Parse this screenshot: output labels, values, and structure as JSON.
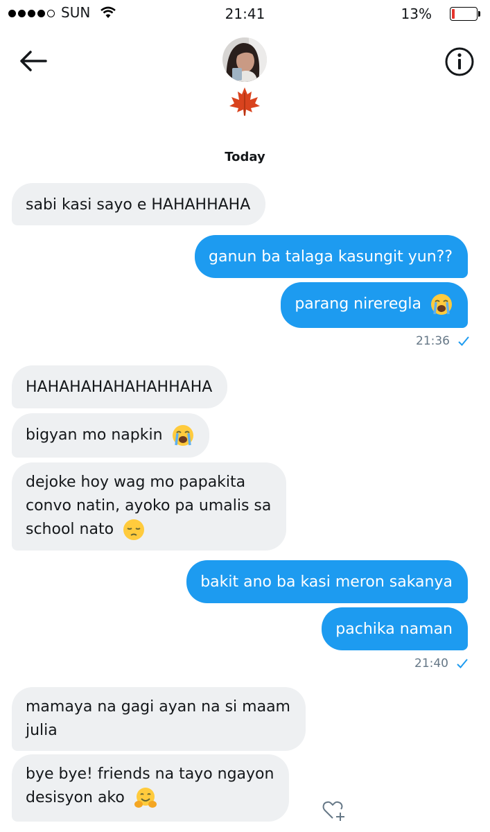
{
  "status_bar": {
    "carrier": "SUN",
    "time": "21:41",
    "battery": "13%",
    "battery_level": 0.13
  },
  "header": {
    "back_icon": "arrow-left-icon",
    "info_icon": "info-icon",
    "contact_emoji": "maple-leaf"
  },
  "date_separator": "Today",
  "messages": [
    {
      "dir": "in",
      "text": "sabi kasi sayo e HAHAHHAHA"
    },
    {
      "dir": "out",
      "text": "ganun ba talaga kasungit yun??"
    },
    {
      "dir": "out",
      "text": "parang nireregla",
      "emoji": "loudly-crying-face"
    },
    {
      "timestamp": "21:36"
    },
    {
      "dir": "in",
      "text": "HAHAHAHAHAHAHHAHA"
    },
    {
      "dir": "in",
      "text": "bigyan mo napkin",
      "emoji": "loudly-crying-face"
    },
    {
      "dir": "in",
      "line1": "dejoke hoy wag mo papakita",
      "line2": "convo natin, ayoko pa umalis sa",
      "line3": "school nato",
      "emoji": "pensive-face"
    },
    {
      "dir": "out",
      "text": "bakit ano ba kasi meron sakanya"
    },
    {
      "dir": "out",
      "text": "pachika naman"
    },
    {
      "timestamp": "21:40"
    },
    {
      "dir": "in",
      "line1": "mamaya na gagi ayan na si maam",
      "line2": "julia"
    },
    {
      "dir": "in",
      "line1": "bye bye! friends na tayo ngayon",
      "line2": "desisyon ako",
      "emoji": "hugging-face"
    }
  ],
  "reaction_icon": "heart-add-icon",
  "colors": {
    "outgoing": "#1d9bf0",
    "incoming": "#eef0f2",
    "check": "#1d9bf0",
    "battery_low": "#e5352d"
  }
}
